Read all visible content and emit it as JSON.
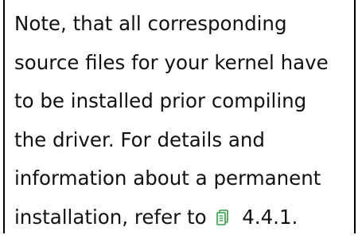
{
  "note": {
    "lines": [
      "Note, that all corresponding",
      "source files for your kernel have",
      "to be installed prior compiling",
      "the driver. For details and",
      "information about a permanent"
    ],
    "last_line_prefix": "installation, refer to",
    "reference": "4.4.1.",
    "reference_icon": "document-reference-icon",
    "icon_color": "#2f9f45"
  }
}
